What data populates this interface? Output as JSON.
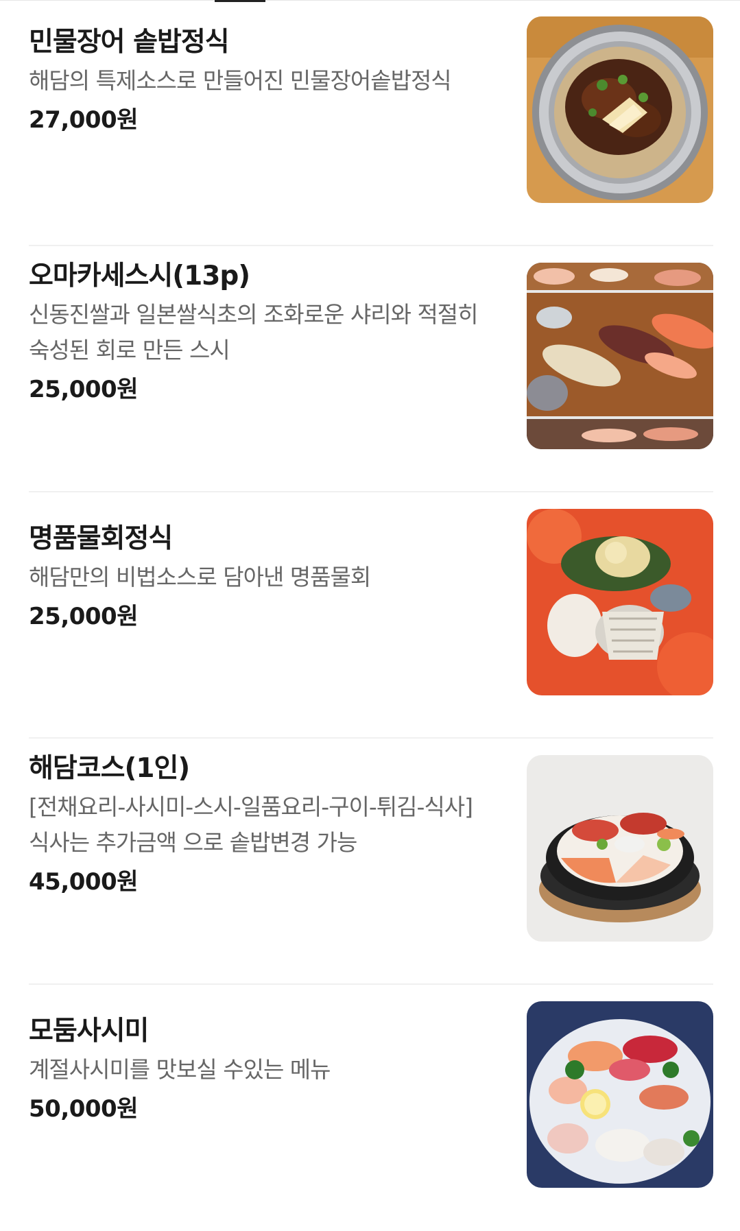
{
  "menu": {
    "items": [
      {
        "name": "민물장어 솥밥정식",
        "description": "해담의 특제소스로 만들어진 민물장어솥밥정식",
        "price": "27,000원",
        "photo_icon": "eel-rice-pot-photo"
      },
      {
        "name": "오마카세스시(13p)",
        "description": "신동진쌀과 일본쌀식초의 조화로운 샤리와 적절히 숙성된 회로 만든 스시",
        "price": "25,000원",
        "photo_icon": "sushi-platter-photo"
      },
      {
        "name": "명품물회정식",
        "description": "해담만의 비법소스로 담아낸 명품물회",
        "price": "25,000원",
        "photo_icon": "cold-raw-fish-soup-photo"
      },
      {
        "name": "해담코스(1인)",
        "description": "[전채요리-사시미-스시-일품요리-구이-튀김-식사] 식사는 추가금액 으로 솥밥변경 가능",
        "price": "45,000원",
        "photo_icon": "course-sashimi-platter-photo"
      },
      {
        "name": "모둠사시미",
        "description": "계절사시미를 맛보실 수있는 메뉴",
        "price": "50,000원",
        "photo_icon": "assorted-sashimi-photo"
      }
    ]
  }
}
